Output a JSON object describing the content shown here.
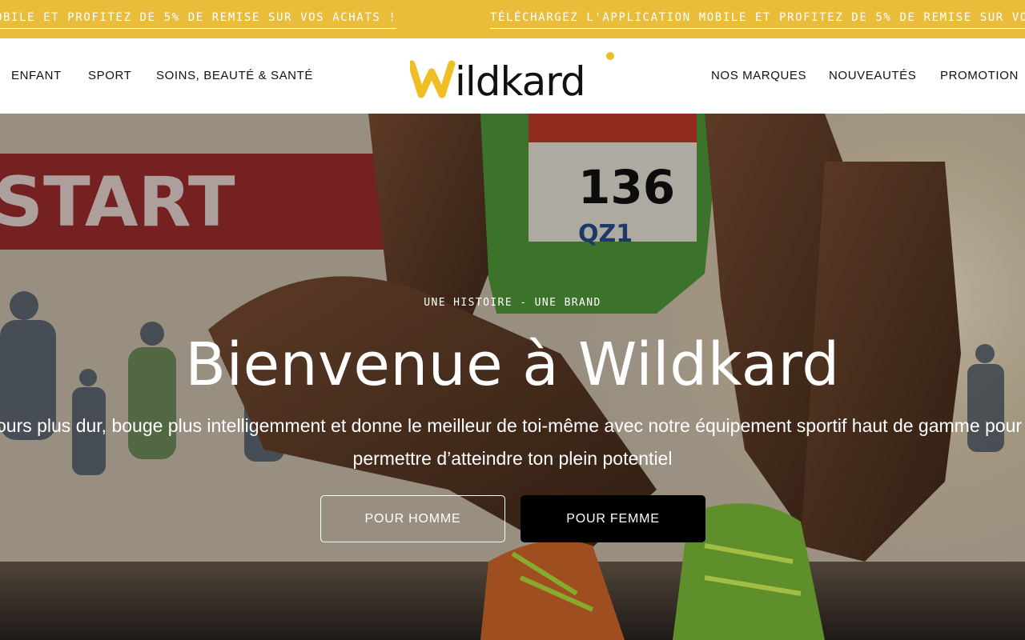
{
  "announcement": {
    "message_partial": "OBILE ET PROFITEZ DE 5% DE REMISE SUR VOS ACHATS !",
    "message_full": "TÉLÉCHARGEZ L'APPLICATION MOBILE ET PROFITEZ DE 5% DE REMISE SUR VOS ACHATS !",
    "background": "#e9bd3a"
  },
  "nav": {
    "left": [
      "ENFANT",
      "SPORT",
      "SOINS, BEAUTÉ & SANTÉ"
    ],
    "right": [
      "NOS MARQUES",
      "NOUVEAUTÉS",
      "PROMOTION"
    ]
  },
  "logo": {
    "text": "Wildkard",
    "accent_color": "#f0bd24",
    "text_color": "#111111"
  },
  "hero": {
    "eyebrow": "UNE HISTOIRE - UNE BRAND",
    "title": "Bienvenue à Wildkard",
    "subtitle_line1": "Cours plus dur, bouge plus intelligemment et donne le meilleur de toi-même avec notre équipement sportif haut de gamme pour te",
    "subtitle_line2": "permettre d’atteindre ton plein potentiel",
    "photo": {
      "banner_text": "START",
      "bib_number": "136",
      "bib_sponsor": "QZ1"
    },
    "buttons": {
      "homme": "POUR HOMME",
      "femme": "POUR FEMME"
    }
  }
}
